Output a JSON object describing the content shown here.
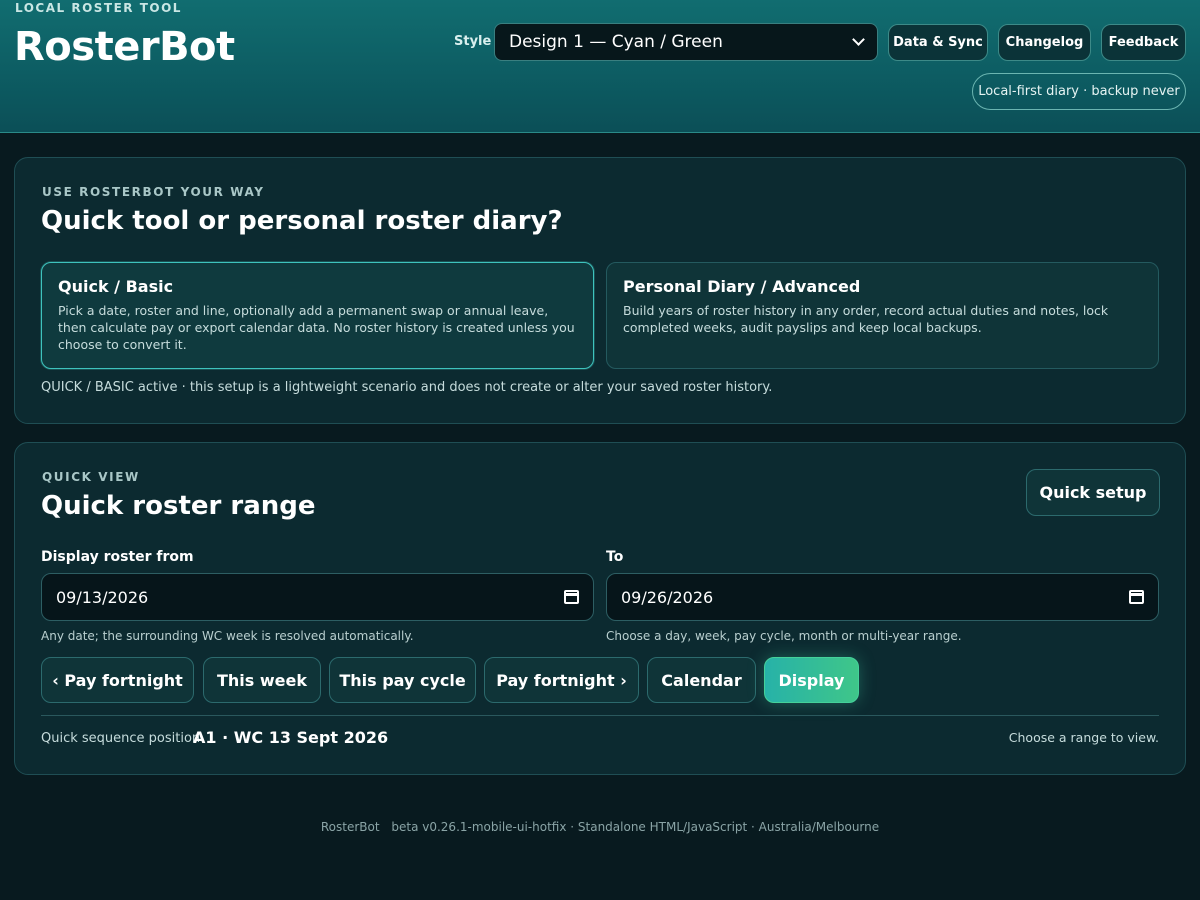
{
  "header": {
    "eyebrow": "LOCAL ROSTER TOOL",
    "brand": "RosterBot",
    "style_label": "Style",
    "style_value": "Design 1 — Cyan / Green",
    "buttons": {
      "data_sync": "Data & Sync",
      "changelog": "Changelog",
      "feedback": "Feedback"
    },
    "status_pill": "Local-first diary · backup never"
  },
  "mode_panel": {
    "eyebrow": "USE ROSTERBOT YOUR WAY",
    "title": "Quick tool or personal roster diary?",
    "cards": [
      {
        "title": "Quick / Basic",
        "description": "Pick a date, roster and line, optionally add a permanent swap or annual leave, then calculate pay or export calendar data. No roster history is created unless you choose to convert it.",
        "active": true
      },
      {
        "title": "Personal Diary / Advanced",
        "description": "Build years of roster history in any order, record actual duties and notes, lock completed weeks, audit payslips and keep local backups.",
        "active": false
      }
    ],
    "status": "QUICK / BASIC active · this setup is a lightweight scenario and does not create or alter your saved roster history."
  },
  "quick_view": {
    "eyebrow": "QUICK VIEW",
    "title": "Quick roster range",
    "quick_setup": "Quick setup",
    "from_label": "Display roster from",
    "from_value": "09/13/2026",
    "from_hint": "Any date; the surrounding WC week is resolved automatically.",
    "to_label": "To",
    "to_value": "09/26/2026",
    "to_hint": "Choose a day, week, pay cycle, month or multi-year range.",
    "range_buttons": {
      "prev_fortnight": "‹ Pay fortnight",
      "this_week": "This week",
      "this_pay_cycle": "This pay cycle",
      "next_fortnight": "Pay fortnight ›",
      "calendar": "Calendar",
      "display": "Display"
    },
    "sequence_label": "Quick sequence position",
    "sequence_value": "A1 · WC 13 Sept 2026",
    "sequence_hint": "Choose a range to view."
  },
  "footer": {
    "app": "RosterBot",
    "version": "beta v0.26.1-mobile-ui-hotfix · Standalone HTML/JavaScript · Australia/Melbourne"
  },
  "colors": {
    "accent": "#3ec3bd",
    "primary_gradient_start": "#27b2a8",
    "primary_gradient_end": "#3fc689",
    "background": "#081a1f"
  }
}
